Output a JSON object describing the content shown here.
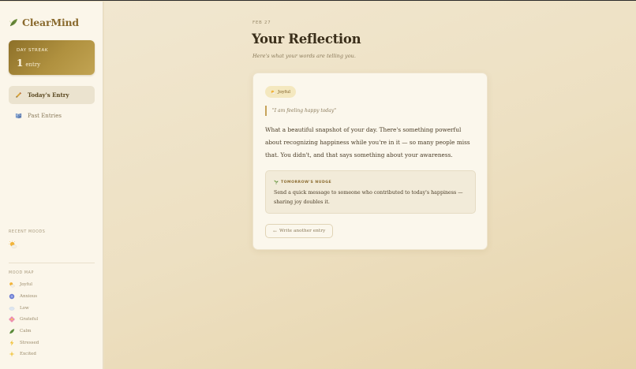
{
  "app": {
    "name": "ClearMind",
    "logo_icon": "leaf-icon"
  },
  "streak": {
    "label": "DAY STREAK",
    "value": "1",
    "unit": "entry"
  },
  "nav": [
    {
      "label": "Today's Entry",
      "icon": "pencil-icon",
      "active": true
    },
    {
      "label": "Past Entries",
      "icon": "book-icon",
      "active": false
    }
  ],
  "recent_moods": {
    "label": "RECENT MOODS",
    "items": [
      "joyful-icon"
    ]
  },
  "mood_map": {
    "label": "MOOD MAP",
    "items": [
      {
        "label": "Joyful",
        "icon": "sun-cloud-icon"
      },
      {
        "label": "Anxious",
        "icon": "anxious-icon"
      },
      {
        "label": "Low",
        "icon": "cloud-icon"
      },
      {
        "label": "Grateful",
        "icon": "flower-icon"
      },
      {
        "label": "Calm",
        "icon": "leaf-icon"
      },
      {
        "label": "Stressed",
        "icon": "lightning-icon"
      },
      {
        "label": "Excited",
        "icon": "sparkle-icon"
      }
    ]
  },
  "main": {
    "date": "FEB 27",
    "title": "Your Reflection",
    "subtitle": "Here's what your words are telling you.",
    "mood_chip": "Joyful",
    "quote": "\"I am feeling happy today\"",
    "reflection": "What a beautiful snapshot of your day. There's something powerful about recognizing happiness while you're in it — so many people miss that. You didn't, and that says something about your awareness.",
    "nudge": {
      "title": "TOMORROW'S NUDGE",
      "text": "Send a quick message to someone who contributed to today's happiness — sharing joy doubles it."
    },
    "write_button": "Write another entry",
    "write_arrow": "←"
  },
  "colors": {
    "accent": "#b0913f",
    "accent_dark": "#8a6a2e",
    "background": "#ede0c2",
    "card": "#fbf7ec"
  }
}
